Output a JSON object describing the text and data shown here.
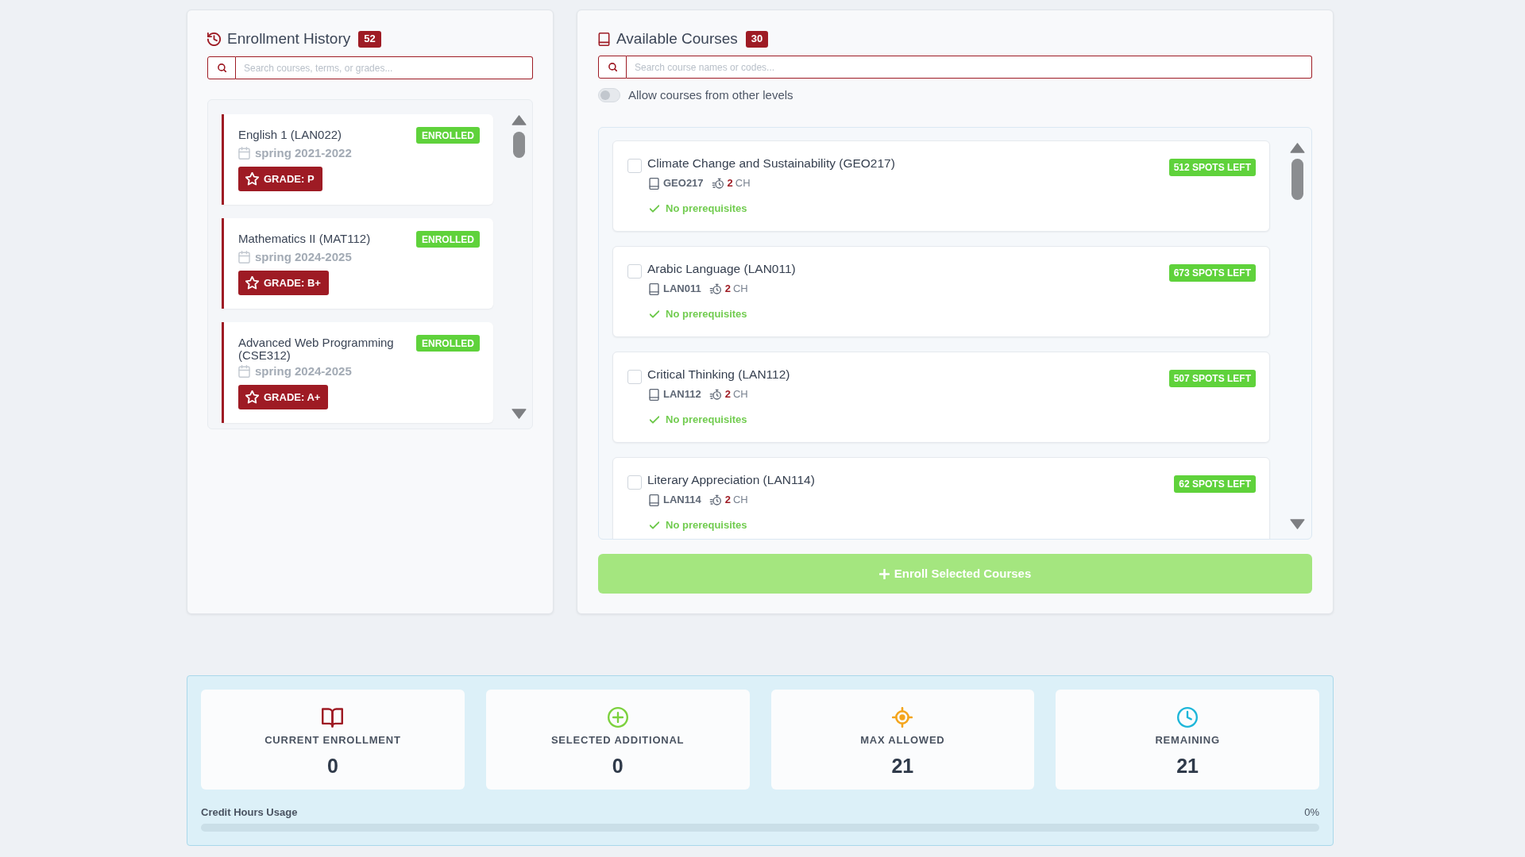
{
  "enrollment_history": {
    "title": "Enrollment History",
    "count": "52",
    "search": {
      "placeholder": "Search courses, terms, or grades..."
    },
    "items": [
      {
        "course": "English 1 (LAN022)",
        "status": "ENROLLED",
        "term": "spring 2021-2022",
        "grade": "GRADE: P"
      },
      {
        "course": "Mathematics II (MAT112)",
        "status": "ENROLLED",
        "term": "spring 2024-2025",
        "grade": "GRADE: B+"
      },
      {
        "course": "Advanced Web Programming (CSE312)",
        "status": "ENROLLED",
        "term": "spring 2024-2025",
        "grade": "GRADE: A+"
      }
    ]
  },
  "available_courses": {
    "title": "Available Courses",
    "count": "30",
    "search": {
      "placeholder": "Search course names or codes..."
    },
    "toggle": {
      "label": "Allow courses from other levels",
      "on": false
    },
    "courses": [
      {
        "name": "Climate Change and Sustainability (GEO217)",
        "code": "GEO217",
        "credits": "2",
        "credit_unit": "CH",
        "prerequisites": "No prerequisites",
        "spots": "512 SPOTS LEFT",
        "checked": false
      },
      {
        "name": "Arabic Language (LAN011)",
        "code": "LAN011",
        "credits": "2",
        "credit_unit": "CH",
        "prerequisites": "No prerequisites",
        "spots": "673 SPOTS LEFT",
        "checked": false
      },
      {
        "name": "Critical Thinking (LAN112)",
        "code": "LAN112",
        "credits": "2",
        "credit_unit": "CH",
        "prerequisites": "No prerequisites",
        "spots": "507 SPOTS LEFT",
        "checked": false
      },
      {
        "name": "Literary Appreciation (LAN114)",
        "code": "LAN114",
        "credits": "2",
        "credit_unit": "CH",
        "prerequisites": "No prerequisites",
        "spots": "62 SPOTS LEFT",
        "checked": false
      }
    ],
    "enroll_button": {
      "label": "Enroll Selected Courses",
      "disabled": true
    }
  },
  "summary": {
    "stats": [
      {
        "kind": "current",
        "label": "CURRENT ENROLLMENT",
        "value": "0"
      },
      {
        "kind": "selected",
        "label": "SELECTED ADDITIONAL",
        "value": "0"
      },
      {
        "kind": "max",
        "label": "MAX ALLOWED",
        "value": "21"
      },
      {
        "kind": "remaining",
        "label": "REMAINING",
        "value": "21"
      }
    ],
    "usage": {
      "label": "Credit Hours Usage",
      "reading": "0%"
    }
  }
}
